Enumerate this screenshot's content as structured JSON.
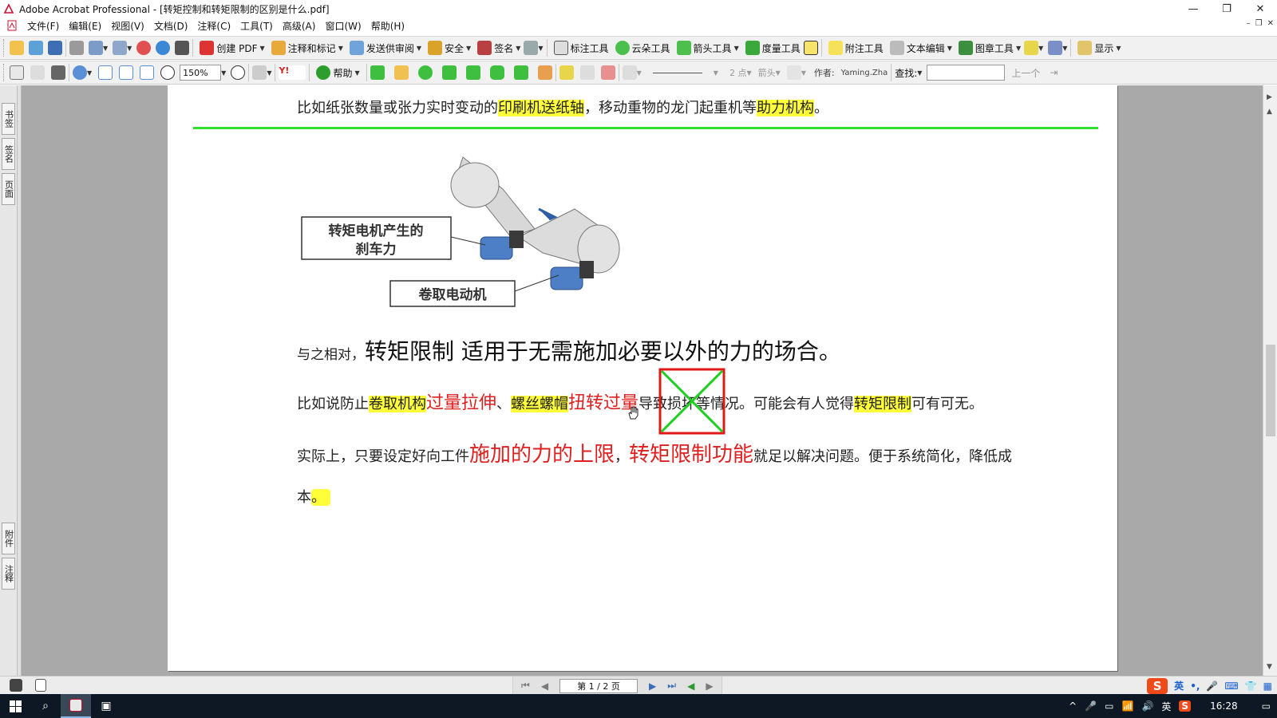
{
  "window": {
    "title": "Adobe Acrobat Professional - [转矩控制和转矩限制的区别是什么.pdf]",
    "controls": [
      "—",
      "❐",
      "✕"
    ],
    "mdi_controls": [
      "–",
      "❐",
      "✕"
    ]
  },
  "menu": [
    "文件(F)",
    "编辑(E)",
    "视图(V)",
    "文档(D)",
    "注释(C)",
    "工具(T)",
    "高级(A)",
    "窗口(W)",
    "帮助(H)"
  ],
  "toolbar1": {
    "create_pdf": "创建 PDF",
    "comment_markup": "注释和标记",
    "send_review": "发送供审阅",
    "secure": "安全",
    "sign": "签名",
    "callout_tool": "标注工具",
    "cloud_tool": "云朵工具",
    "arrow_tool": "箭头工具",
    "measure_tool": "度量工具",
    "note_tool": "附注工具",
    "text_edit": "文本编辑",
    "stamp_tool": "图章工具",
    "display": "显示"
  },
  "toolbar2": {
    "zoom": "150%",
    "help": "帮助",
    "line_weight": "2 点",
    "arrow": "箭头",
    "author_label": "作者:",
    "author": "Yaming.Zha",
    "find_label": "查找:",
    "prev_label": "上一个"
  },
  "left_nav_tabs": [
    "书签",
    "签名",
    "页面",
    "附件",
    "注释"
  ],
  "page": {
    "line_top": {
      "pre": "比如纸张数量或张力实时变动的",
      "hl1": "印刷机送纸轴",
      "mid": "，移动重物的龙门起重机等",
      "hl2": "助力机构",
      "end": "。"
    },
    "figure": {
      "label_brake": [
        "转矩电机产生的",
        "刹车力"
      ],
      "label_winder": "卷取电动机"
    },
    "heading": {
      "small": "与之相对，",
      "big": "转矩限制  适用于无需施加必要以外的力的场合。"
    },
    "para1": {
      "pre": "比如说防止",
      "hl1": "卷取机构",
      "red1": "过量拉伸",
      "sep": "、",
      "hl2": "螺丝螺帽",
      "red2": "扭转过量",
      "mid": "导致损坏等情况。可能会有人觉得",
      "hl3": "转矩限制",
      "end": "可有可无。"
    },
    "para2": {
      "pre": "实际上，只要设定好向工件",
      "red1": "施加的力的上限",
      "comma": "，",
      "red2": "转矩限制功能",
      "end": "就足以解决问题。便于系统简化，降低成"
    },
    "para3": {
      "text": "本",
      "hl": "。"
    }
  },
  "statusbar": {
    "page_indicator": "第 1 / 2 页",
    "ime": [
      "英",
      "•,",
      "🎤",
      "⌨",
      "👕",
      "▦"
    ]
  },
  "taskbar": {
    "tray": [
      "^",
      "🎤",
      "▭",
      "📶",
      "🔊",
      "英",
      "S"
    ],
    "time": "16:28"
  }
}
